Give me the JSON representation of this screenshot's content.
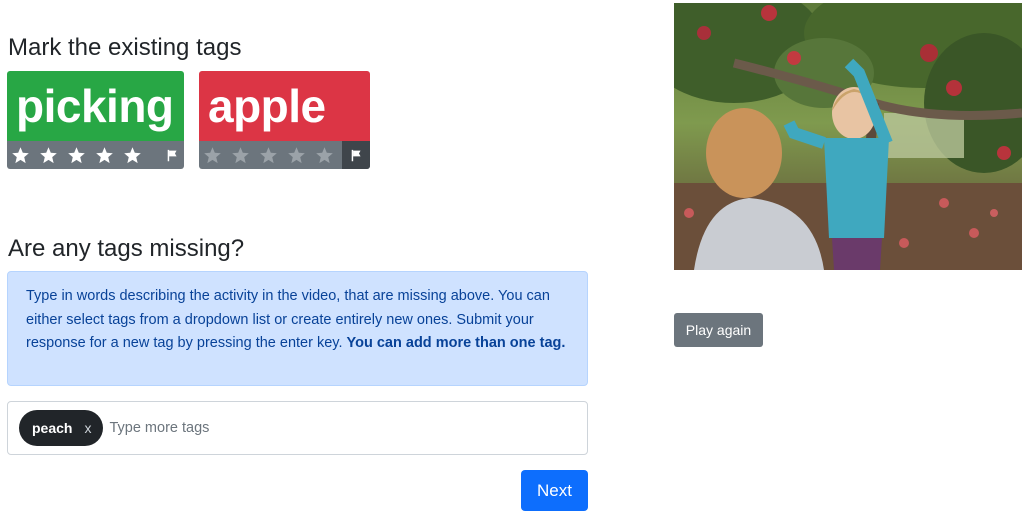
{
  "existing": {
    "heading": "Mark the existing tags",
    "tags": [
      {
        "label": "picking",
        "color": "#28a745",
        "rating": 5,
        "max_rating": 5,
        "flagged": false
      },
      {
        "label": "apple",
        "color": "#dc3545",
        "rating": 0,
        "max_rating": 5,
        "flagged": true
      }
    ]
  },
  "missing": {
    "heading": "Are any tags missing?",
    "info_text": "Type in words describing the activity in the video, that are missing above. You can either select tags from a dropdown list or create entirely new ones. Submit your response for a new tag by pressing the enter key. ",
    "info_bold": "You can add more than one tag.",
    "chips": [
      {
        "label": "peach",
        "remove": "x"
      }
    ],
    "input_placeholder": "Type more tags",
    "input_value": ""
  },
  "buttons": {
    "next_label": "Next",
    "play_again_label": "Play again"
  },
  "colors": {
    "primary": "#0d6efd",
    "secondary": "#6c757d",
    "info_bg": "#cfe2ff",
    "info_text": "#084298",
    "chip_bg": "#212529"
  },
  "icons": {
    "rating": "star-icon",
    "flag": "flag-icon",
    "remove": "close-icon"
  }
}
